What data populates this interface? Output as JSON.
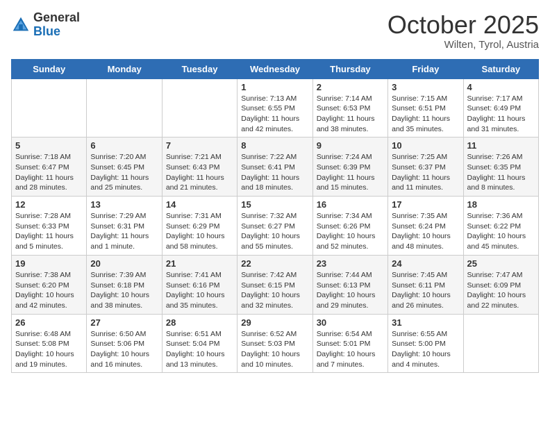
{
  "header": {
    "logo": {
      "general": "General",
      "blue": "Blue"
    },
    "title": "October 2025",
    "location": "Wilten, Tyrol, Austria"
  },
  "days_of_week": [
    "Sunday",
    "Monday",
    "Tuesday",
    "Wednesday",
    "Thursday",
    "Friday",
    "Saturday"
  ],
  "weeks": [
    [
      {
        "day": "",
        "info": ""
      },
      {
        "day": "",
        "info": ""
      },
      {
        "day": "",
        "info": ""
      },
      {
        "day": "1",
        "info": "Sunrise: 7:13 AM\nSunset: 6:55 PM\nDaylight: 11 hours and 42 minutes."
      },
      {
        "day": "2",
        "info": "Sunrise: 7:14 AM\nSunset: 6:53 PM\nDaylight: 11 hours and 38 minutes."
      },
      {
        "day": "3",
        "info": "Sunrise: 7:15 AM\nSunset: 6:51 PM\nDaylight: 11 hours and 35 minutes."
      },
      {
        "day": "4",
        "info": "Sunrise: 7:17 AM\nSunset: 6:49 PM\nDaylight: 11 hours and 31 minutes."
      }
    ],
    [
      {
        "day": "5",
        "info": "Sunrise: 7:18 AM\nSunset: 6:47 PM\nDaylight: 11 hours and 28 minutes."
      },
      {
        "day": "6",
        "info": "Sunrise: 7:20 AM\nSunset: 6:45 PM\nDaylight: 11 hours and 25 minutes."
      },
      {
        "day": "7",
        "info": "Sunrise: 7:21 AM\nSunset: 6:43 PM\nDaylight: 11 hours and 21 minutes."
      },
      {
        "day": "8",
        "info": "Sunrise: 7:22 AM\nSunset: 6:41 PM\nDaylight: 11 hours and 18 minutes."
      },
      {
        "day": "9",
        "info": "Sunrise: 7:24 AM\nSunset: 6:39 PM\nDaylight: 11 hours and 15 minutes."
      },
      {
        "day": "10",
        "info": "Sunrise: 7:25 AM\nSunset: 6:37 PM\nDaylight: 11 hours and 11 minutes."
      },
      {
        "day": "11",
        "info": "Sunrise: 7:26 AM\nSunset: 6:35 PM\nDaylight: 11 hours and 8 minutes."
      }
    ],
    [
      {
        "day": "12",
        "info": "Sunrise: 7:28 AM\nSunset: 6:33 PM\nDaylight: 11 hours and 5 minutes."
      },
      {
        "day": "13",
        "info": "Sunrise: 7:29 AM\nSunset: 6:31 PM\nDaylight: 11 hours and 1 minute."
      },
      {
        "day": "14",
        "info": "Sunrise: 7:31 AM\nSunset: 6:29 PM\nDaylight: 10 hours and 58 minutes."
      },
      {
        "day": "15",
        "info": "Sunrise: 7:32 AM\nSunset: 6:27 PM\nDaylight: 10 hours and 55 minutes."
      },
      {
        "day": "16",
        "info": "Sunrise: 7:34 AM\nSunset: 6:26 PM\nDaylight: 10 hours and 52 minutes."
      },
      {
        "day": "17",
        "info": "Sunrise: 7:35 AM\nSunset: 6:24 PM\nDaylight: 10 hours and 48 minutes."
      },
      {
        "day": "18",
        "info": "Sunrise: 7:36 AM\nSunset: 6:22 PM\nDaylight: 10 hours and 45 minutes."
      }
    ],
    [
      {
        "day": "19",
        "info": "Sunrise: 7:38 AM\nSunset: 6:20 PM\nDaylight: 10 hours and 42 minutes."
      },
      {
        "day": "20",
        "info": "Sunrise: 7:39 AM\nSunset: 6:18 PM\nDaylight: 10 hours and 38 minutes."
      },
      {
        "day": "21",
        "info": "Sunrise: 7:41 AM\nSunset: 6:16 PM\nDaylight: 10 hours and 35 minutes."
      },
      {
        "day": "22",
        "info": "Sunrise: 7:42 AM\nSunset: 6:15 PM\nDaylight: 10 hours and 32 minutes."
      },
      {
        "day": "23",
        "info": "Sunrise: 7:44 AM\nSunset: 6:13 PM\nDaylight: 10 hours and 29 minutes."
      },
      {
        "day": "24",
        "info": "Sunrise: 7:45 AM\nSunset: 6:11 PM\nDaylight: 10 hours and 26 minutes."
      },
      {
        "day": "25",
        "info": "Sunrise: 7:47 AM\nSunset: 6:09 PM\nDaylight: 10 hours and 22 minutes."
      }
    ],
    [
      {
        "day": "26",
        "info": "Sunrise: 6:48 AM\nSunset: 5:08 PM\nDaylight: 10 hours and 19 minutes."
      },
      {
        "day": "27",
        "info": "Sunrise: 6:50 AM\nSunset: 5:06 PM\nDaylight: 10 hours and 16 minutes."
      },
      {
        "day": "28",
        "info": "Sunrise: 6:51 AM\nSunset: 5:04 PM\nDaylight: 10 hours and 13 minutes."
      },
      {
        "day": "29",
        "info": "Sunrise: 6:52 AM\nSunset: 5:03 PM\nDaylight: 10 hours and 10 minutes."
      },
      {
        "day": "30",
        "info": "Sunrise: 6:54 AM\nSunset: 5:01 PM\nDaylight: 10 hours and 7 minutes."
      },
      {
        "day": "31",
        "info": "Sunrise: 6:55 AM\nSunset: 5:00 PM\nDaylight: 10 hours and 4 minutes."
      },
      {
        "day": "",
        "info": ""
      }
    ]
  ]
}
